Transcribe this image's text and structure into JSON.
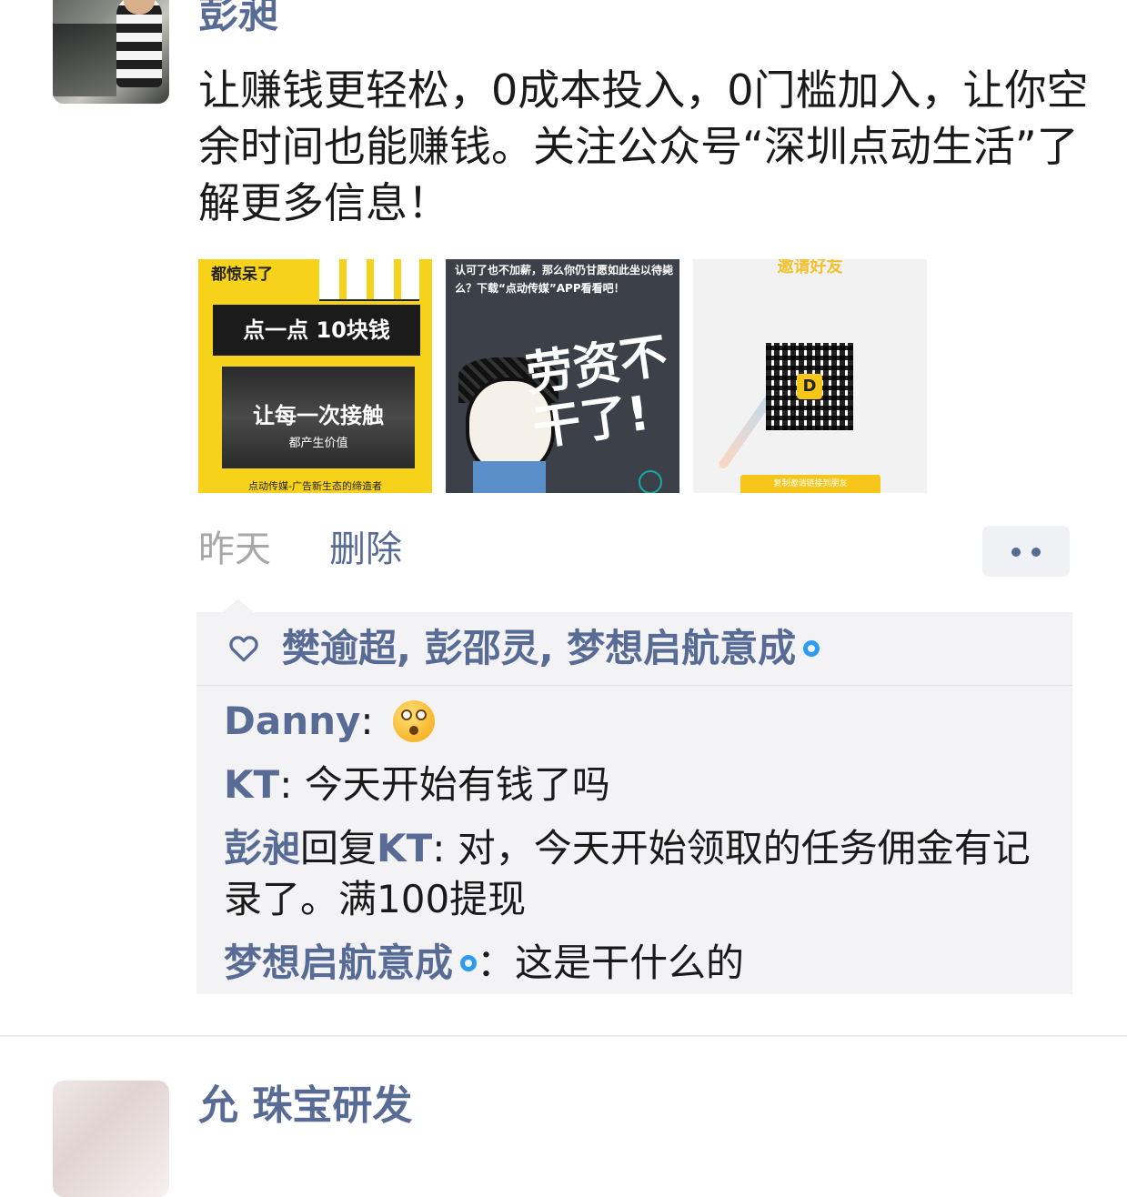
{
  "post": {
    "author": "彭昶",
    "text": "让赚钱更轻松，0成本投入，0门槛加入，让你空余时间也能赚钱。关注公众号“深圳点动生活”了解更多信息！",
    "images": [
      {
        "top": "都惊呆了",
        "banner": "点一点 10块钱",
        "photo_title": "让每一次接触",
        "photo_sub": "都产生价值",
        "footer": "点动传媒-广告新生态的缔造者"
      },
      {
        "text": "认可了也不加薪，那么你仍甘愿如此坐以待毙么？下载“点动传媒”APP看看吧！",
        "big": "劳资不干了!"
      },
      {
        "top": "邀请好友",
        "logo": "D",
        "button": "复制邀请链接到朋友"
      }
    ],
    "time": "昨天",
    "delete_label": "删除"
  },
  "likes": {
    "names": "樊逾超, 彭邵灵, 梦想启航意成"
  },
  "comments": [
    {
      "name": "Danny",
      "sep": ": ",
      "emoji": "flushed-emoji"
    },
    {
      "name": "KT",
      "sep": ": ",
      "text": "今天开始有钱了吗"
    },
    {
      "name": "彭昶",
      "reply_word": "回复",
      "reply_to": "KT",
      "sep": ": ",
      "text": "对，今天开始领取的任务佣金有记录了。满100提现"
    },
    {
      "name": "梦想启航意成",
      "sep": "：",
      "text": "这是干什么的"
    }
  ],
  "next_post": {
    "author": "允 珠宝研发"
  },
  "colors": {
    "link": "#576b95",
    "feedback_bg": "#f3f3f5",
    "time_gray": "#a7a7a7",
    "status_ring": "#2d9cf0"
  }
}
